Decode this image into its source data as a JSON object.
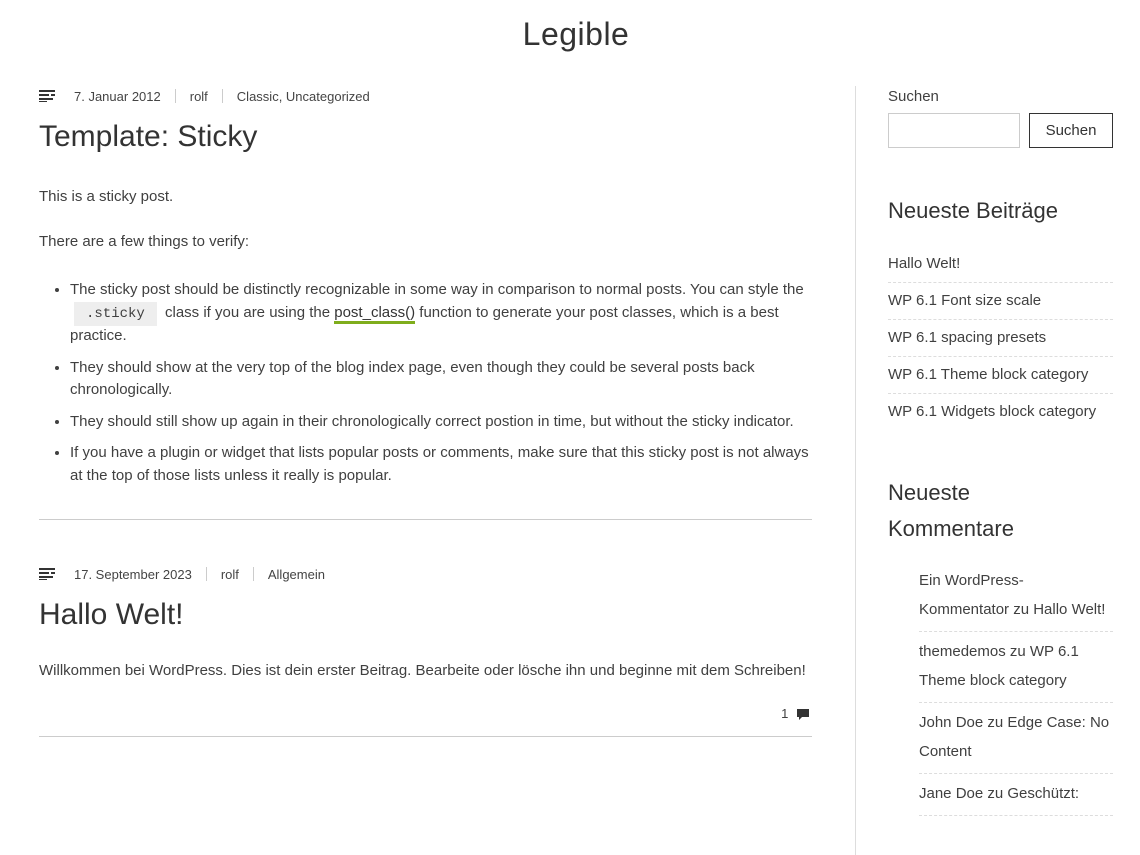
{
  "site_title": "Legible",
  "posts": [
    {
      "date": "7. Januar 2012",
      "author": "rolf",
      "categories": "Classic, Uncategorized",
      "title": "Template: Sticky",
      "p1": "This is a sticky post.",
      "p2": "There are a few things to verify:",
      "li1_a": "The sticky post should be distinctly recognizable in some way in comparison to normal posts. You can style the",
      "li1_code": ".sticky",
      "li1_b": "class if you are using the",
      "li1_link": "post_class()",
      "li1_c": "function to generate your post classes, which is a best practice.",
      "li2": "They should show at the very top of the blog index page, even though they could be several posts back chronologically.",
      "li3": "They should still show up again in their chronologically correct postion in time, but without the sticky indicator.",
      "li4": "If you have a plugin or widget that lists popular posts or comments, make sure that this sticky post is not always at the top of those lists unless it really is popular."
    },
    {
      "date": "17. September 2023",
      "author": "rolf",
      "categories": "Allgemein",
      "title": "Hallo Welt!",
      "p1": "Willkommen bei WordPress. Dies ist dein erster Beitrag. Bearbeite oder lösche ihn und beginne mit dem Schreiben!",
      "comments": "1"
    }
  ],
  "sidebar": {
    "search_label": "Suchen",
    "search_button": "Suchen",
    "recent_title": "Neueste Beiträge",
    "recent": [
      "Hallo Welt!",
      "WP 6.1 Font size scale",
      "WP 6.1 spacing presets",
      "WP 6.1 Theme block category",
      "WP 6.1 Widgets block category"
    ],
    "comments_title": "Neueste Kommentare",
    "comments": [
      "Ein WordPress-Kommentator zu Hallo Welt!",
      "themedemos zu WP 6.1 Theme block category",
      "John Doe zu Edge Case: No Content",
      "Jane Doe zu Geschützt:"
    ]
  }
}
